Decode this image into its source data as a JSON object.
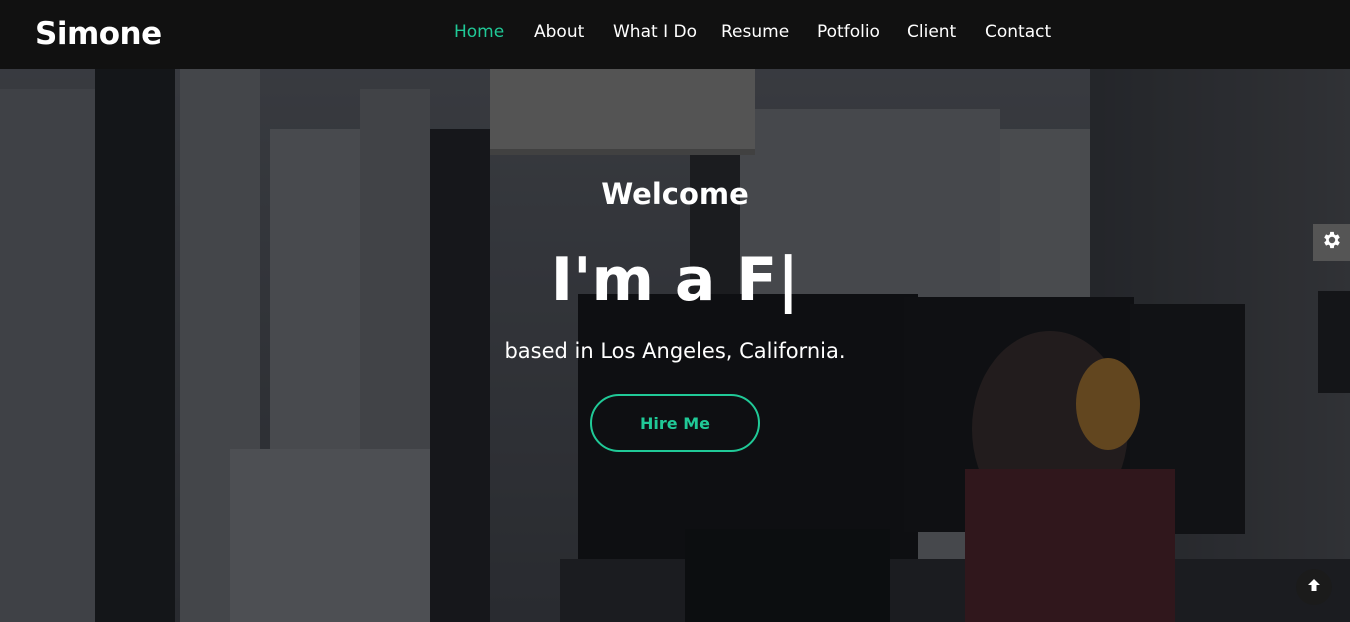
{
  "brand": "Simone",
  "nav": {
    "items": [
      {
        "label": "Home",
        "active": true
      },
      {
        "label": "About",
        "active": false
      },
      {
        "label": "What I Do",
        "active": false
      },
      {
        "label": "Resume",
        "active": false
      },
      {
        "label": "Potfolio",
        "active": false
      },
      {
        "label": "Client",
        "active": false
      },
      {
        "label": "Contact",
        "active": false
      }
    ]
  },
  "hero": {
    "welcome": "Welcome",
    "headline": "I'm a F|",
    "subline": "based in Los Angeles, California.",
    "cta_label": "Hire Me"
  },
  "icons": {
    "settings": "gear-icon",
    "back_to_top": "arrow-up-icon"
  },
  "colors": {
    "accent": "#20c997",
    "navbar_bg": "#111111",
    "text": "#ffffff"
  }
}
